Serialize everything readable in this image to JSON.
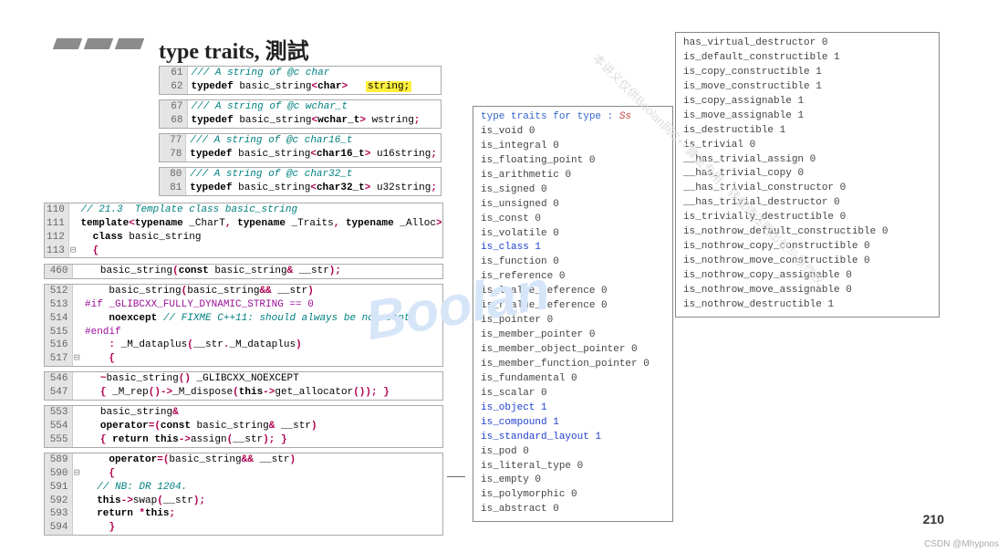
{
  "title": "type traits, 測試",
  "page_num": "210",
  "credit": "CSDN @Mhypnos",
  "watermark": "Boolan",
  "watermark2": "本讲义仅供Boolan网C++算法专用，转载请注明出处与原作权。",
  "codebox1": [
    {
      "ln": "61",
      "code_html": "<span class='cmt'>/// A string of @c char</span>"
    },
    {
      "ln": "62",
      "code_html": "<span class='kw'>typedef</span> basic_string<span class='angle'>&lt;</span><span class='kw'>char</span><span class='angle'>&gt;</span>   <span class='hl-yellow'>string;</span>"
    }
  ],
  "codebox2": [
    {
      "ln": "67",
      "code_html": "<span class='cmt'>/// A string of @c wchar_t</span>"
    },
    {
      "ln": "68",
      "code_html": "<span class='kw'>typedef</span> basic_string<span class='angle'>&lt;</span><span class='kw'>wchar_t</span><span class='angle'>&gt;</span> wstring<span class='punct'>;</span>"
    }
  ],
  "codebox3": [
    {
      "ln": "77",
      "code_html": "<span class='cmt'>/// A string of @c char16_t</span>"
    },
    {
      "ln": "78",
      "code_html": "<span class='kw'>typedef</span> basic_string<span class='angle'>&lt;</span><span class='kw'>char16_t</span><span class='angle'>&gt;</span> u16string<span class='punct'>;</span>"
    }
  ],
  "codebox4": [
    {
      "ln": "80",
      "code_html": "<span class='cmt'>/// A string of @c char32_t</span>"
    },
    {
      "ln": "81",
      "code_html": "<span class='kw'>typedef</span> basic_string<span class='angle'>&lt;</span><span class='kw'>char32_t</span><span class='angle'>&gt;</span> u32string<span class='punct'>;</span>"
    }
  ],
  "codebox5": [
    {
      "ln": "110",
      "fld": "",
      "code_html": "<span class='cmt'>// 21.3  Template class basic_string</span>"
    },
    {
      "ln": "111",
      "fld": "",
      "code_html": "<span class='kw'>template</span><span class='angle'>&lt;</span><span class='kw'>typename</span> _CharT<span class='punct'>,</span> <span class='kw'>typename</span> _Traits<span class='punct'>,</span> <span class='kw'>typename</span> _Alloc<span class='angle'>&gt;</span>"
    },
    {
      "ln": "112",
      "fld": "",
      "code_html": "  <span class='kw'>class</span> basic_string"
    },
    {
      "ln": "113",
      "fld": "⊟",
      "code_html": "  <span class='brace'>{</span>"
    }
  ],
  "codebox6": [
    {
      "ln": "460",
      "code_html": "    basic_string<span class='punct'>(</span><span class='kw'>const</span> basic_string<span class='punct'>&amp;</span> __str<span class='punct'>);</span>"
    }
  ],
  "codebox7": [
    {
      "ln": "512",
      "fld": "",
      "code_html": "    basic_string<span class='punct'>(</span>basic_string<span class='punct'>&amp;&amp;</span> __str<span class='punct'>)</span>"
    },
    {
      "ln": "513",
      "fld": "",
      "code_html": "<span class='pp'>#if _GLIBCXX_FULLY_DYNAMIC_STRING == 0</span>"
    },
    {
      "ln": "514",
      "fld": "",
      "code_html": "    <span class='kw'>noexcept</span> <span class='cmt'>// FIXME C++11: should always be noexcept.</span>"
    },
    {
      "ln": "515",
      "fld": "",
      "code_html": "<span class='pp'>#endif</span>"
    },
    {
      "ln": "516",
      "fld": "",
      "code_html": "    <span class='punct'>:</span> _M_dataplus<span class='punct'>(</span>__str<span class='punct'>.</span>_M_dataplus<span class='punct'>)</span>"
    },
    {
      "ln": "517",
      "fld": "⊟",
      "code_html": "    <span class='brace'>{</span>"
    }
  ],
  "codebox8": [
    {
      "ln": "546",
      "code_html": "    <span class='punct'>~</span>basic_string<span class='punct'>()</span> _GLIBCXX_NOEXCEPT"
    },
    {
      "ln": "547",
      "code_html": "    <span class='brace'>{</span> _M_rep<span class='punct'>()-&gt;</span>_M_dispose<span class='punct'>(</span><span class='kw'>this</span><span class='punct'>-&gt;</span>get_allocator<span class='punct'>());</span> <span class='brace'>}</span>"
    }
  ],
  "codebox9": [
    {
      "ln": "553",
      "code_html": "    basic_string<span class='punct'>&amp;</span>"
    },
    {
      "ln": "554",
      "code_html": "    <span class='kw'>operator</span><span class='punct'>=(</span><span class='kw'>const</span> basic_string<span class='punct'>&amp;</span> __str<span class='punct'>)</span>"
    },
    {
      "ln": "555",
      "code_html": "    <span class='brace'>{</span> <span class='kw'>return</span> <span class='kw'>this</span><span class='punct'>-&gt;</span>assign<span class='punct'>(</span>__str<span class='punct'>);</span> <span class='brace'>}</span>"
    }
  ],
  "codebox10": [
    {
      "ln": "589",
      "fld": "",
      "code_html": "    <span class='kw'>operator</span><span class='punct'>=(</span>basic_string<span class='punct'>&amp;&amp;</span> __str<span class='punct'>)</span>"
    },
    {
      "ln": "590",
      "fld": "⊟",
      "code_html": "    <span class='brace'>{</span>"
    },
    {
      "ln": "591",
      "fld": "",
      "code_html": "  <span class='cmt'>// NB: DR 1204.</span>"
    },
    {
      "ln": "592",
      "fld": "",
      "code_html": "  <span class='kw'>this</span><span class='punct'>-&gt;</span>swap<span class='punct'>(</span>__str<span class='punct'>);</span>"
    },
    {
      "ln": "593",
      "fld": "",
      "code_html": "  <span class='kw'>return</span> <span class='punct'>*</span><span class='kw'>this</span><span class='punct'>;</span>"
    },
    {
      "ln": "594",
      "fld": "",
      "code_html": "    <span class='brace'>}</span>"
    }
  ],
  "traits_header": {
    "label": "type traits for type : ",
    "value": "Ss"
  },
  "traits1": [
    {
      "n": "is_void",
      "v": "0",
      "pad": 0
    },
    {
      "n": "is_integral",
      "v": "0",
      "pad": 6
    },
    {
      "n": "is_floating_point",
      "v": "0",
      "pad": 0
    },
    {
      "n": "is_arithmetic",
      "v": "0",
      "pad": 4
    },
    {
      "n": "is_signed",
      "v": "0",
      "pad": 8
    },
    {
      "n": "is_unsigned",
      "v": "0",
      "pad": 6
    },
    {
      "n": "is_const",
      "v": "0",
      "pad": 9
    },
    {
      "n": "is_volatile",
      "v": "0",
      "pad": 6
    },
    {
      "n": "is_class",
      "v": "1",
      "pad": 9,
      "cls": "blue"
    },
    {
      "n": "is_function",
      "v": "0",
      "pad": 6
    },
    {
      "n": "is_reference",
      "v": "0",
      "pad": 5
    },
    {
      "n": "is_lvalue_reference",
      "v": "0",
      "pad": 0
    },
    {
      "n": "is_rvalue_reference",
      "v": "0",
      "pad": 0
    },
    {
      "n": "is_pointer",
      "v": "0",
      "pad": 7
    },
    {
      "n": "is_member_pointer",
      "v": "0",
      "pad": 3
    },
    {
      "n": "is_member_object_pointer",
      "v": "0",
      "pad": 3
    },
    {
      "n": "is_member_function_pointer",
      "v": "0",
      "pad": 0
    },
    {
      "n": "is_fundamental",
      "v": "0",
      "pad": 3
    },
    {
      "n": "is_scalar",
      "v": "0",
      "pad": 8
    },
    {
      "n": "is_object",
      "v": "1",
      "pad": 8,
      "cls": "blue"
    },
    {
      "n": "is_compound",
      "v": "1",
      "pad": 6,
      "cls": "blue"
    },
    {
      "n": "is_standard_layout",
      "v": "1",
      "pad": 0,
      "cls": "blue"
    },
    {
      "n": "is_pod",
      "v": "0",
      "pad": 1
    },
    {
      "n": "is_literal_type",
      "v": "0",
      "pad": 0
    },
    {
      "n": "is_empty",
      "v": "0",
      "pad": 9
    },
    {
      "n": "is_polymorphic",
      "v": "0",
      "pad": 3
    },
    {
      "n": "is_abstract",
      "v": "0",
      "pad": 6
    }
  ],
  "traits2": [
    {
      "n": "has_virtual_destructor",
      "v": "0",
      "pad": 2
    },
    {
      "n": "is_default_constructible",
      "v": "1",
      "pad": 0
    },
    {
      "n": "is_copy_constructible",
      "v": "1",
      "pad": 4
    },
    {
      "n": "is_move_constructible",
      "v": "1",
      "pad": 4
    },
    {
      "n": "is_copy_assignable",
      "v": "1",
      "pad": 7
    },
    {
      "n": "is_move_assignable",
      "v": "1",
      "pad": 7
    },
    {
      "n": "is_destructible",
      "v": "1",
      "pad": 0
    },
    {
      "n": "is_trivial",
      "v": "0",
      "pad": 7
    },
    {
      "n": "__has_trivial_assign",
      "v": "0",
      "pad": 5
    },
    {
      "n": "__has_trivial_copy",
      "v": "0",
      "pad": 7
    },
    {
      "n": "__has_trivial_constructor",
      "v": "0",
      "pad": 0
    },
    {
      "n": "__has_trivial_destructor",
      "v": "0",
      "pad": 1
    },
    {
      "n": "is_trivially_destructible",
      "v": "0",
      "pad": 0
    },
    {
      "n": "is_nothrow_default_constructible",
      "v": "0",
      "pad": 0
    },
    {
      "n": "is_nothrow_copy_constructible",
      "v": "0",
      "pad": 3
    },
    {
      "n": "is_nothrow_move_constructible",
      "v": "0",
      "pad": 3
    },
    {
      "n": "is_nothrow_copy_assignable",
      "v": "0",
      "pad": 6
    },
    {
      "n": "is_nothrow_move_assignable",
      "v": "0",
      "pad": 6
    },
    {
      "n": "is_nothrow_destructible",
      "v": "1",
      "pad": 0
    }
  ]
}
